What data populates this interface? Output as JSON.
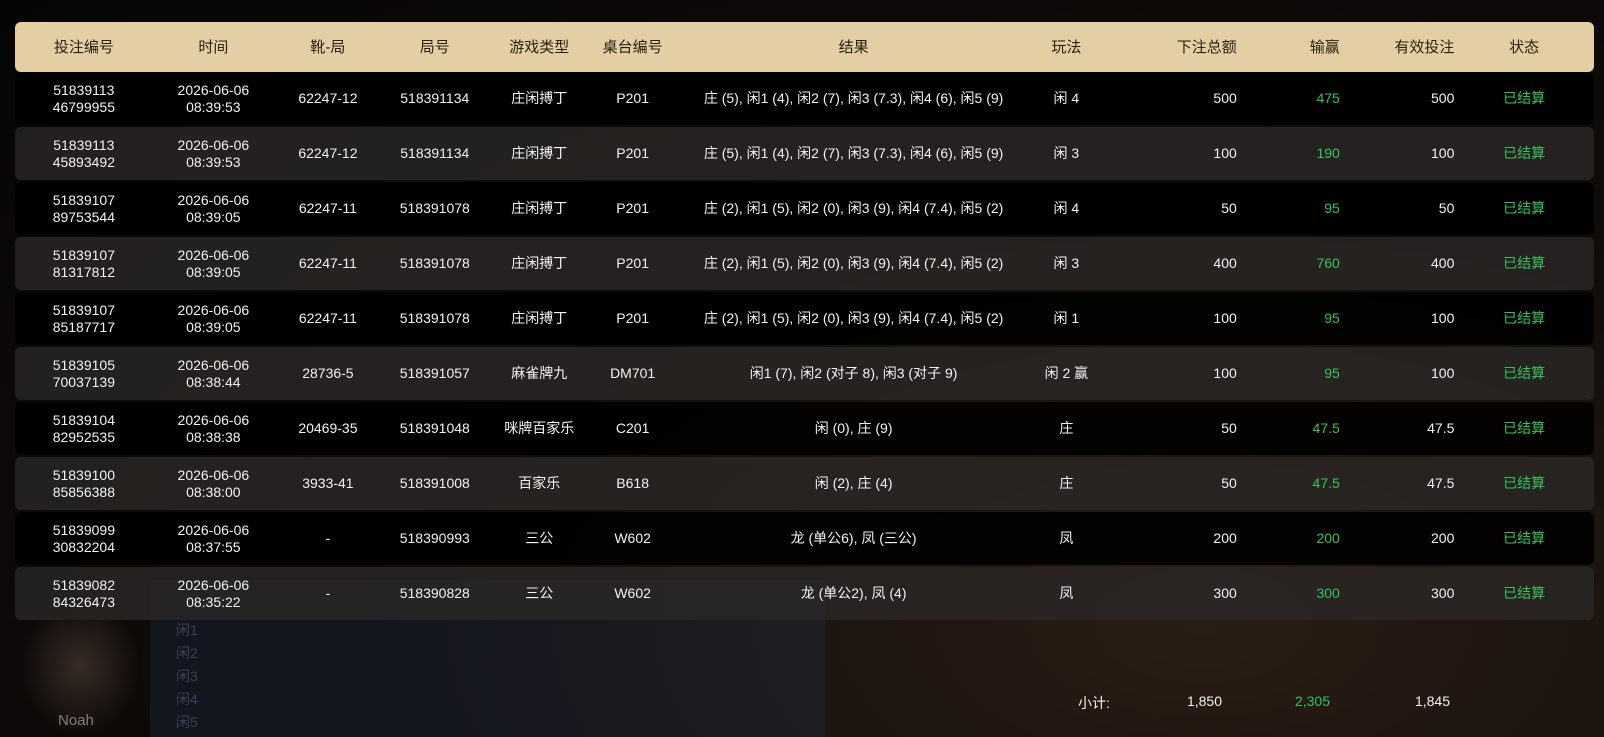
{
  "colors": {
    "header_bg": "#e4cfa4",
    "win_green": "#36c25a",
    "status_green": "#36c25a",
    "row_dark": "#000000",
    "row_alt": "#2a2826"
  },
  "background": {
    "dealer_name": "Noah",
    "row_labels": [
      "闲1",
      "闲2",
      "闲3",
      "闲4",
      "闲5"
    ]
  },
  "table": {
    "headers": {
      "bet_id": "投注编号",
      "time": "时间",
      "shoe_round": "靴-局",
      "round_no": "局号",
      "game_type": "游戏类型",
      "table_no": "桌台编号",
      "result": "结果",
      "play": "玩法",
      "total_bet": "下注总额",
      "win_loss": "输赢",
      "valid_bet": "有效投注",
      "status": "状态"
    },
    "rows": [
      {
        "id1": "51839113",
        "id2": "46799955",
        "date": "2026-06-06",
        "clock": "08:39:53",
        "shoe": "62247-12",
        "round": "518391134",
        "game": "庄闲搏丁",
        "table": "P201",
        "result": "庄 (5), 闲1 (4), 闲2 (7), 闲3 (7.3), 闲4 (6), 闲5 (9)",
        "play": "闲 4",
        "bet": "500",
        "win": "475",
        "valid": "500",
        "status": "已结算"
      },
      {
        "id1": "51839113",
        "id2": "45893492",
        "date": "2026-06-06",
        "clock": "08:39:53",
        "shoe": "62247-12",
        "round": "518391134",
        "game": "庄闲搏丁",
        "table": "P201",
        "result": "庄 (5), 闲1 (4), 闲2 (7), 闲3 (7.3), 闲4 (6), 闲5 (9)",
        "play": "闲 3",
        "bet": "100",
        "win": "190",
        "valid": "100",
        "status": "已结算"
      },
      {
        "id1": "51839107",
        "id2": "89753544",
        "date": "2026-06-06",
        "clock": "08:39:05",
        "shoe": "62247-11",
        "round": "518391078",
        "game": "庄闲搏丁",
        "table": "P201",
        "result": "庄 (2), 闲1 (5), 闲2 (0), 闲3 (9), 闲4 (7.4), 闲5 (2)",
        "play": "闲 4",
        "bet": "50",
        "win": "95",
        "valid": "50",
        "status": "已结算"
      },
      {
        "id1": "51839107",
        "id2": "81317812",
        "date": "2026-06-06",
        "clock": "08:39:05",
        "shoe": "62247-11",
        "round": "518391078",
        "game": "庄闲搏丁",
        "table": "P201",
        "result": "庄 (2), 闲1 (5), 闲2 (0), 闲3 (9), 闲4 (7.4), 闲5 (2)",
        "play": "闲 3",
        "bet": "400",
        "win": "760",
        "valid": "400",
        "status": "已结算"
      },
      {
        "id1": "51839107",
        "id2": "85187717",
        "date": "2026-06-06",
        "clock": "08:39:05",
        "shoe": "62247-11",
        "round": "518391078",
        "game": "庄闲搏丁",
        "table": "P201",
        "result": "庄 (2), 闲1 (5), 闲2 (0), 闲3 (9), 闲4 (7.4), 闲5 (2)",
        "play": "闲 1",
        "bet": "100",
        "win": "95",
        "valid": "100",
        "status": "已结算"
      },
      {
        "id1": "51839105",
        "id2": "70037139",
        "date": "2026-06-06",
        "clock": "08:38:44",
        "shoe": "28736-5",
        "round": "518391057",
        "game": "麻雀牌九",
        "table": "DM701",
        "result": "闲1 (7), 闲2 (对子 8), 闲3 (对子 9)",
        "play": "闲 2 赢",
        "bet": "100",
        "win": "95",
        "valid": "100",
        "status": "已结算"
      },
      {
        "id1": "51839104",
        "id2": "82952535",
        "date": "2026-06-06",
        "clock": "08:38:38",
        "shoe": "20469-35",
        "round": "518391048",
        "game": "咪牌百家乐",
        "table": "C201",
        "result": "闲 (0), 庄 (9)",
        "play": "庄",
        "bet": "50",
        "win": "47.5",
        "valid": "47.5",
        "status": "已结算"
      },
      {
        "id1": "51839100",
        "id2": "85856388",
        "date": "2026-06-06",
        "clock": "08:38:00",
        "shoe": "3933-41",
        "round": "518391008",
        "game": "百家乐",
        "table": "B618",
        "result": "闲 (2), 庄 (4)",
        "play": "庄",
        "bet": "50",
        "win": "47.5",
        "valid": "47.5",
        "status": "已结算"
      },
      {
        "id1": "51839099",
        "id2": "30832204",
        "date": "2026-06-06",
        "clock": "08:37:55",
        "shoe": "-",
        "round": "518390993",
        "game": "三公",
        "table": "W602",
        "result": "龙 (单公6), 凤 (三公)",
        "play": "凤",
        "bet": "200",
        "win": "200",
        "valid": "200",
        "status": "已结算"
      },
      {
        "id1": "51839082",
        "id2": "84326473",
        "date": "2026-06-06",
        "clock": "08:35:22",
        "shoe": "-",
        "round": "518390828",
        "game": "三公",
        "table": "W602",
        "result": "龙 (单公2), 凤 (4)",
        "play": "凤",
        "bet": "300",
        "win": "300",
        "valid": "300",
        "status": "已结算"
      }
    ]
  },
  "summary": {
    "label": "小计:",
    "total_bet": "1,850",
    "total_win": "2,305",
    "total_valid": "1,845"
  }
}
